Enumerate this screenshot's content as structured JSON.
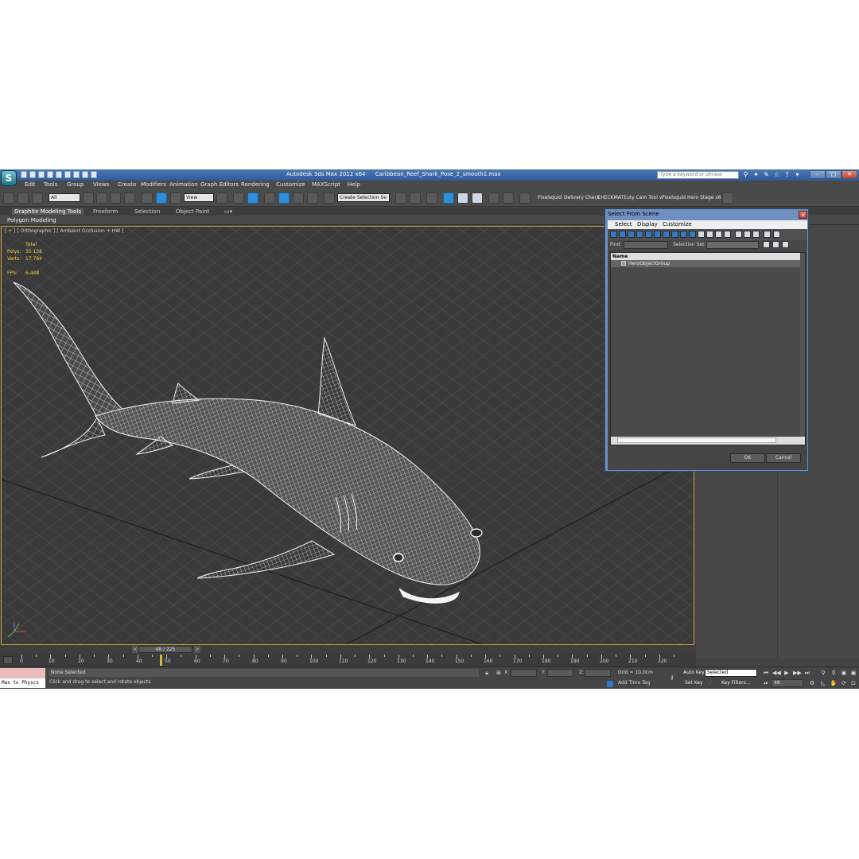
{
  "window": {
    "app_name": "Autodesk 3ds Max  2012 x64",
    "file_name": "Caribbean_Reef_Shark_Pose_2_smooth1.max",
    "search_placeholder": "Type a keyword or phrase",
    "logo_glyph": "S"
  },
  "menu": [
    "Edit",
    "Tools",
    "Group",
    "Views",
    "Create",
    "Modifiers",
    "Animation",
    "Graph Editors",
    "Rendering",
    "Customize",
    "MAXScript",
    "Help"
  ],
  "toolbar": {
    "filter_value": "All",
    "coord_system": "View",
    "selection_set": "Create Selection Se",
    "named_buttons": [
      "Pixelsquid",
      "Delivery Check",
      "CHECKMATE",
      "uty Cam Tool v",
      "Pixelsquid",
      "Hero Stage v6"
    ]
  },
  "ribbon": {
    "tabs": [
      "Graphite Modeling Tools",
      "Freeform",
      "Selection",
      "Object Paint"
    ],
    "active_tab": "Graphite Modeling Tools",
    "panel": "Polygon Modeling"
  },
  "viewport": {
    "label": "[ + ] [ Orthographic ] [ Ambient Occlusion + HW ]",
    "stats": {
      "total_label": "Total",
      "polys_label": "Polys:",
      "polys_value": "35 158",
      "verts_label": "Verts:",
      "verts_value": "17 784",
      "fps_label": "FPS:",
      "fps_value": "6,448"
    },
    "stats_color": "#f2d23c",
    "model": "Caribbean reef shark wireframe mesh"
  },
  "timeslider": {
    "position": "48 / 225",
    "current_frame": 48,
    "total_frames": 225,
    "prev": "<",
    "next": ">"
  },
  "trackbar": {
    "ticks": [
      "0",
      "10",
      "20",
      "30",
      "40",
      "50",
      "60",
      "70",
      "80",
      "90",
      "100",
      "110",
      "120",
      "130",
      "140",
      "150",
      "160",
      "170",
      "180",
      "190",
      "200",
      "210",
      "220"
    ]
  },
  "status": {
    "maxscript_label": "Max to Physcs",
    "selection": "None Selected",
    "prompt": "Click and drag to select and rotate objects",
    "x_label": "X:",
    "y_label": "Y:",
    "z_label": "Z:",
    "grid": "Grid = 10,0cm",
    "add_time_tag": "Add Time Tag",
    "auto_key": "Auto Key",
    "set_key": "Set Key",
    "selected_dropdown": "Selected",
    "key_filters": "Key Filters...",
    "frame_value": "48"
  },
  "dialog": {
    "title": "Select From Scene",
    "menu": [
      "Select",
      "Display",
      "Customize"
    ],
    "find_label": "Find:",
    "selection_set_label": "Selection Set:",
    "column_name": "Name",
    "items": [
      "HeroObjectGroup"
    ],
    "ok": "OK",
    "cancel": "Cancel"
  }
}
